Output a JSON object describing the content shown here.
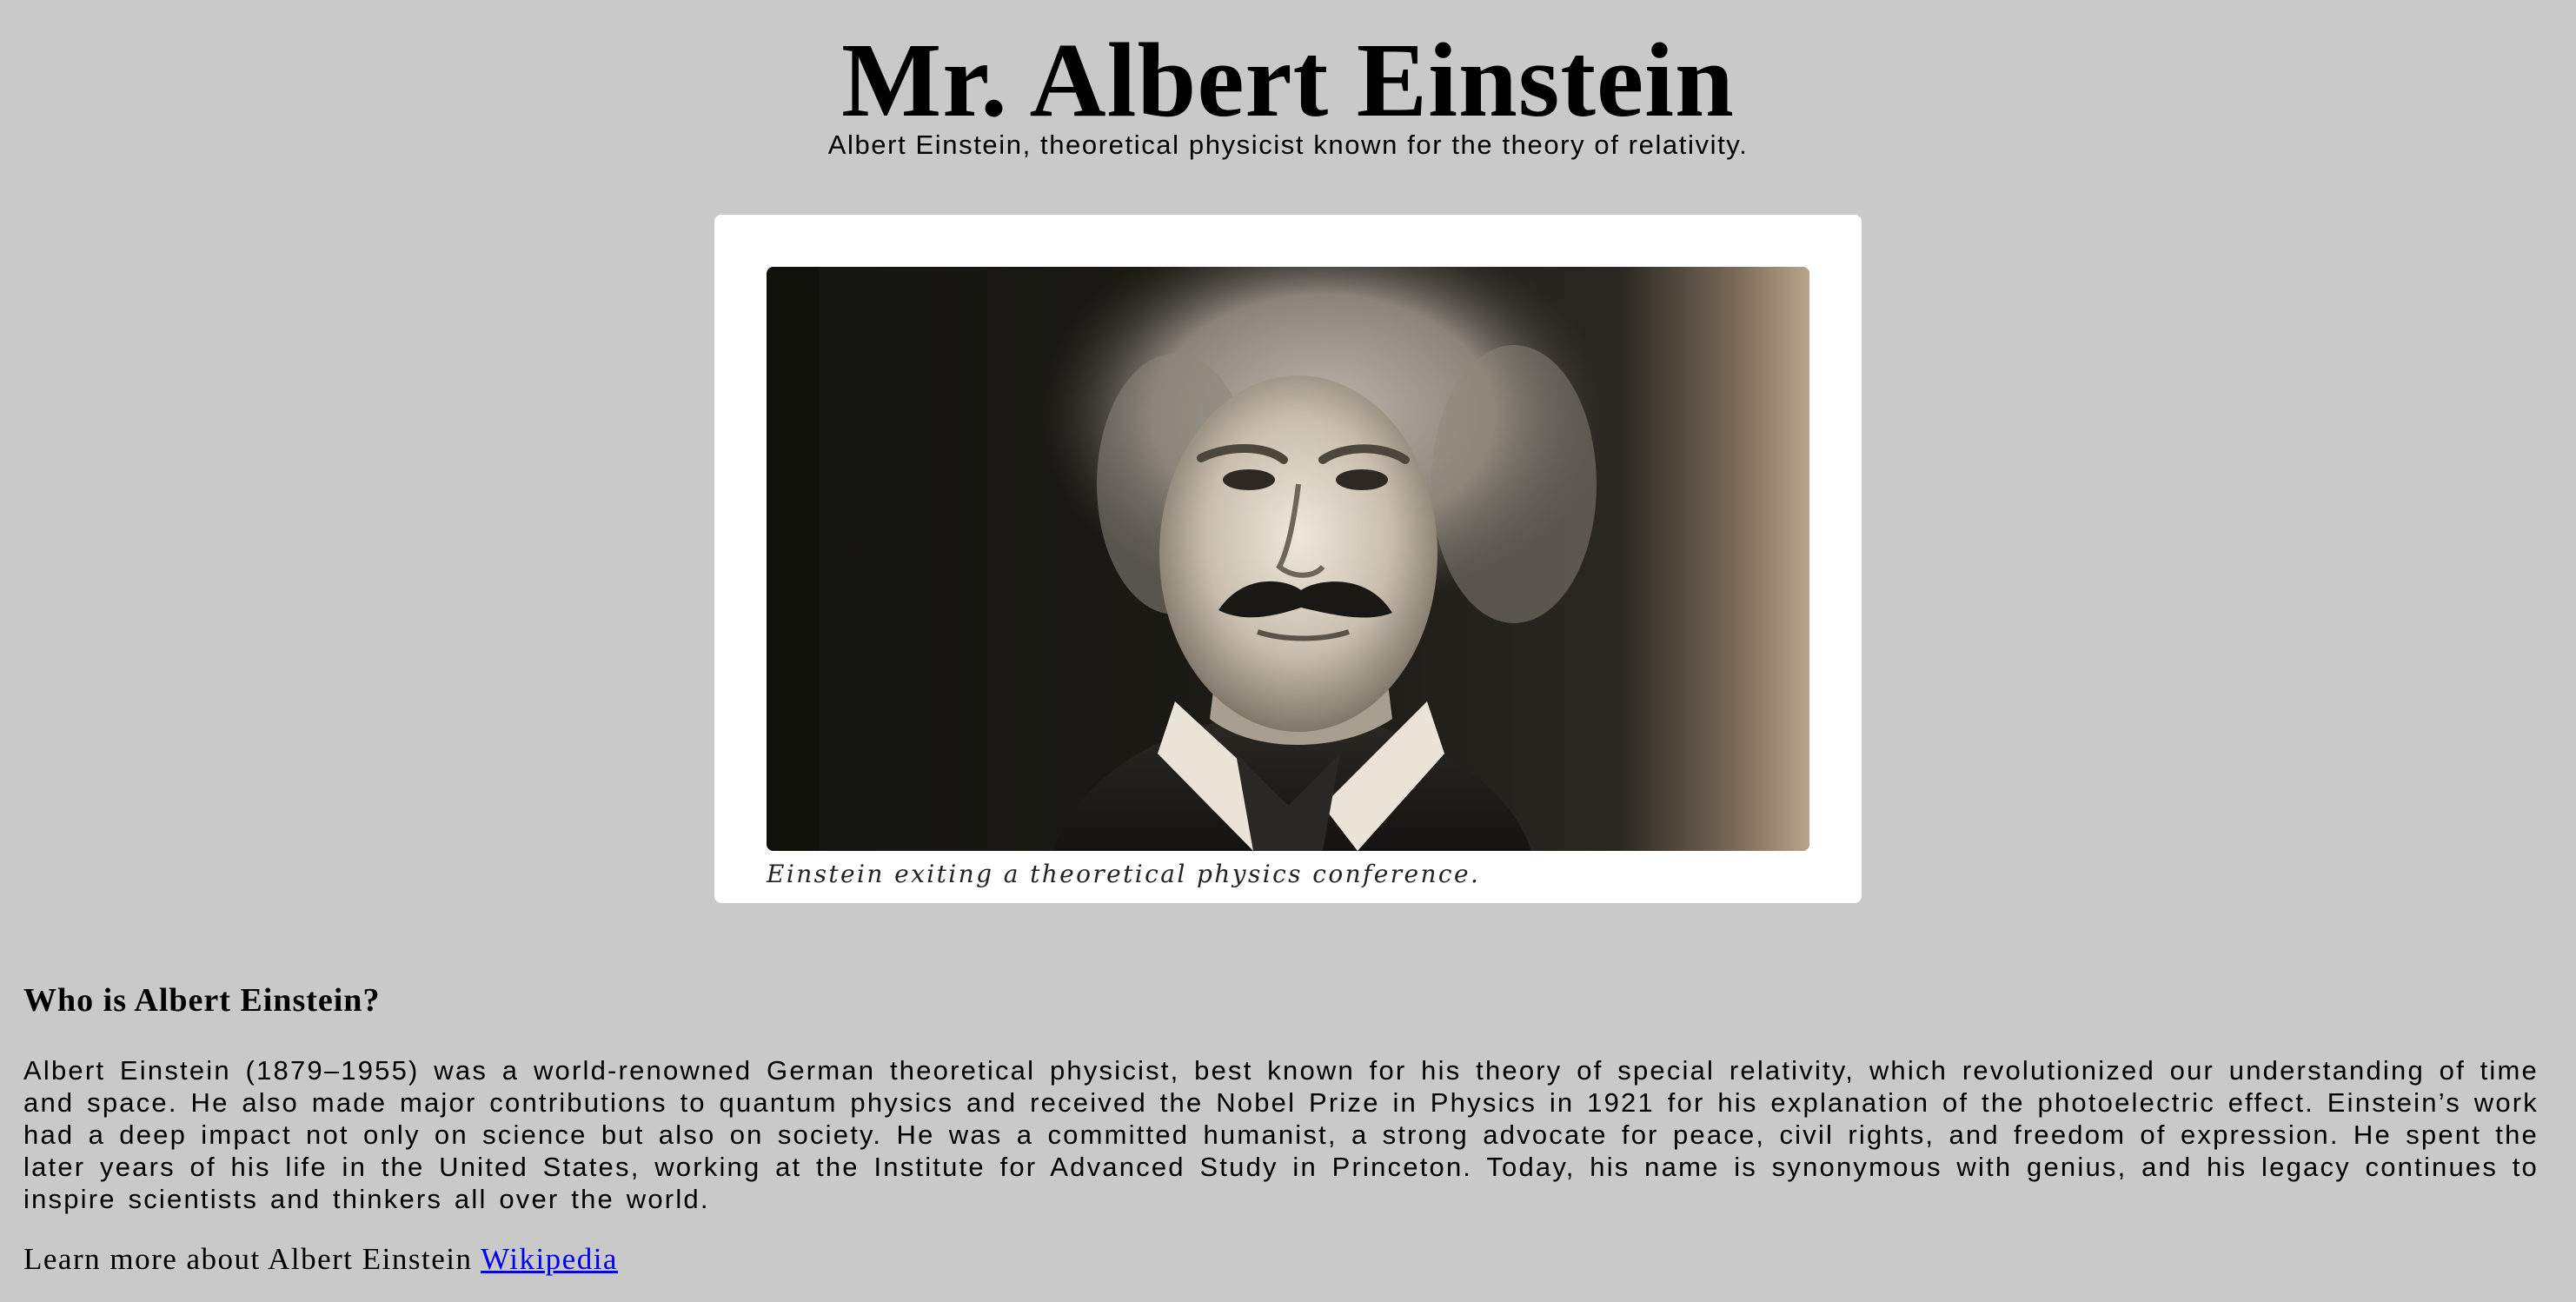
{
  "page": {
    "title": "Mr. Albert Einstein",
    "subtitle": "Albert Einstein, theoretical physicist known for the theory of relativity."
  },
  "figure": {
    "image_alt": "Portrait photograph of Albert Einstein",
    "caption": "Einstein exiting a theoretical physics conference."
  },
  "section": {
    "heading": "Who is Albert Einstein?",
    "body": "Albert Einstein (1879–1955) was a world-renowned German theoretical physicist, best known for his theory of special relativity, which revolutionized our understanding of time and space. He also made major contributions to quantum physics and received the Nobel Prize in Physics in 1921 for his explanation of the photoelectric effect. Einstein’s work had a deep impact not only on science but also on society. He was a committed humanist, a strong advocate for peace, civil rights, and freedom of expression. He spent the later years of his life in the United States, working at the Institute for Advanced Study in Princeton. Today, his name is synonymous with genius, and his legacy continues to inspire scientists and thinkers all over the world."
  },
  "learn_more": {
    "prefix": "Learn more about Albert Einstein",
    "link_label": "Wikipedia"
  },
  "colors": {
    "background": "#c9c9c9",
    "card": "#ffffff",
    "link": "#0000ee"
  }
}
